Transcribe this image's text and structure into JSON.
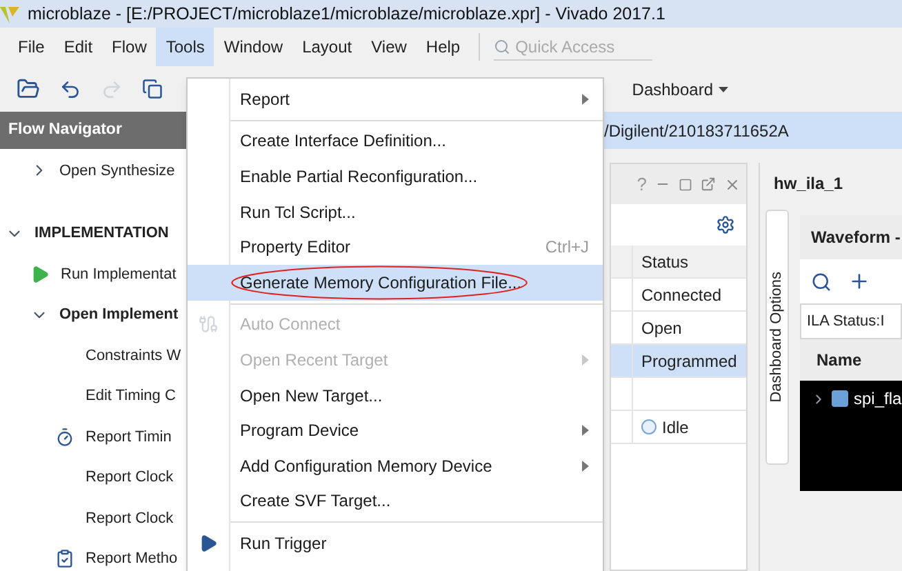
{
  "window": {
    "title": "microblaze - [E:/PROJECT/microblaze1/microblaze/microblaze.xpr] - Vivado 2017.1"
  },
  "menu_bar": [
    {
      "label": "File",
      "selected": false
    },
    {
      "label": "Edit",
      "selected": false
    },
    {
      "label": "Flow",
      "selected": false
    },
    {
      "label": "Tools",
      "selected": true
    },
    {
      "label": "Window",
      "selected": false
    },
    {
      "label": "Layout",
      "selected": false
    },
    {
      "label": "View",
      "selected": false
    },
    {
      "label": "Help",
      "selected": false
    }
  ],
  "quick_access": {
    "placeholder": "Quick Access"
  },
  "toolbar": {
    "layout_menu": "Dashboard"
  },
  "flow_navigator": {
    "title": "Flow Navigator",
    "items": [
      {
        "label": "Open Synthesize",
        "kind": "node",
        "expanded": false
      },
      {
        "label": "IMPLEMENTATION",
        "kind": "section",
        "expanded": true,
        "children": [
          {
            "label": "Run Implementat",
            "kind": "run"
          },
          {
            "label": "Open Implement",
            "kind": "node",
            "expanded": true,
            "children": [
              {
                "label": "Constraints W",
                "kind": "plain"
              },
              {
                "label": "Edit Timing C",
                "kind": "plain"
              },
              {
                "label": "Report Timin",
                "kind": "timer"
              },
              {
                "label": "Report Clock",
                "kind": "plain"
              },
              {
                "label": "Report Clock",
                "kind": "plain"
              },
              {
                "label": "Report Metho",
                "kind": "clipboard"
              }
            ]
          }
        ]
      }
    ]
  },
  "target_path": "/Digilent/210183711652A",
  "hardware": {
    "help": "?",
    "column": "Status",
    "rows": [
      {
        "status": "Connected",
        "selected": false,
        "kind": "text"
      },
      {
        "status": "Open",
        "selected": false,
        "kind": "text"
      },
      {
        "status": "Programmed",
        "selected": true,
        "kind": "text"
      },
      {
        "status": "",
        "selected": false,
        "kind": "empty"
      },
      {
        "status": "Idle",
        "selected": false,
        "kind": "idle"
      }
    ]
  },
  "ila": {
    "tab": "hw_ila_1",
    "side_tab": "Dashboard Options",
    "waveform_title": "Waveform -",
    "status": "ILA Status:I",
    "column": "Name",
    "signal": "spi_fla"
  },
  "tools_menu": [
    {
      "kind": "submenu",
      "label": "Report",
      "disabled": false
    },
    {
      "kind": "separator"
    },
    {
      "kind": "item",
      "label": "Create Interface Definition...",
      "disabled": false
    },
    {
      "kind": "item",
      "label": "Enable Partial Reconfiguration...",
      "disabled": false
    },
    {
      "kind": "item",
      "label": "Run Tcl Script...",
      "disabled": false
    },
    {
      "kind": "item",
      "label": "Property Editor",
      "shortcut": "Ctrl+J",
      "disabled": false
    },
    {
      "kind": "item",
      "label": "Generate Memory Configuration File...",
      "disabled": false,
      "selected": true,
      "circled": true
    },
    {
      "kind": "separator"
    },
    {
      "kind": "connect",
      "label": "Auto Connect",
      "disabled": true
    },
    {
      "kind": "submenu",
      "label": "Open Recent Target",
      "disabled": true
    },
    {
      "kind": "item",
      "label": "Open New Target...",
      "disabled": false
    },
    {
      "kind": "submenu",
      "label": "Program Device",
      "disabled": false
    },
    {
      "kind": "submenu",
      "label": "Add Configuration Memory Device",
      "disabled": false
    },
    {
      "kind": "item",
      "label": "Create SVF Target...",
      "disabled": false
    },
    {
      "kind": "separator"
    },
    {
      "kind": "trigger",
      "label": "Run Trigger",
      "disabled": false
    }
  ]
}
